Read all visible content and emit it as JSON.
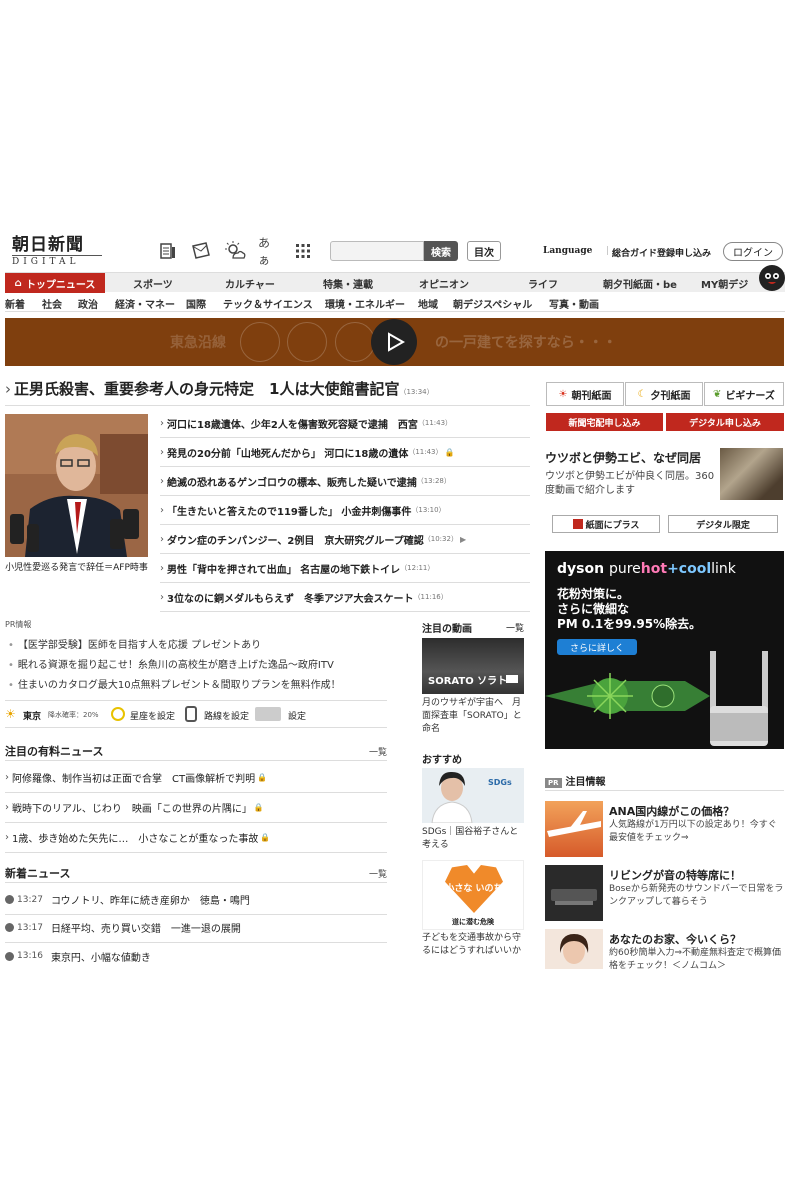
{
  "header": {
    "logo_main": "朝日新聞",
    "logo_sub": "DIGITAL",
    "search_placeholder": "",
    "search_button": "検索",
    "index_button": "目次",
    "language": "Language",
    "guide": "総合ガイド",
    "register": "登録申し込み",
    "login": "ログイン",
    "hiragana_icon_text": "あぁ"
  },
  "nav_primary": [
    {
      "label": "トップニュース",
      "active": true
    },
    {
      "label": "スポーツ"
    },
    {
      "label": "カルチャー"
    },
    {
      "label": "特集・連載"
    },
    {
      "label": "オピニオン"
    },
    {
      "label": "ライフ"
    },
    {
      "label": "朝夕刊紙面・be"
    },
    {
      "label": "MY朝デジ"
    }
  ],
  "nav_secondary": [
    "新着",
    "社会",
    "政治",
    "経済・マネー",
    "国際",
    "テック＆サイエンス",
    "環境・エネルギー",
    "地域",
    "朝デジスペシャル",
    "写真・動画"
  ],
  "banner": {
    "text_left": "東急沿線",
    "text_right": "の一戸建てを探すなら・・・"
  },
  "main_headline": {
    "title": "正男氏殺害、重要参考人の身元特定　1人は大使館書記官",
    "time": "（13:34）"
  },
  "photo_caption": "小児性愛巡る発言で辞任＝AFP時事",
  "headlines": [
    {
      "title": "河口に18歳遺体、少年2人を傷害致死容疑で逮捕　西宮",
      "time": "（11:43）",
      "lock": false
    },
    {
      "title": "発見の20分前「山地死んだから」 河口に18歳の遺体",
      "time": "（11:43）",
      "lock": true
    },
    {
      "title": "絶滅の恐れあるゲンゴロウの標本、販売した疑いで逮捕",
      "time": "（13:28）",
      "lock": false
    },
    {
      "title": "「生きたいと答えたので119番した」 小金井刺傷事件",
      "time": "（13:10）",
      "lock": false
    },
    {
      "title": "ダウン症のチンパンジー、2例目　京大研究グループ確認",
      "time": "（10:32）",
      "lock": false
    },
    {
      "title": "男性「背中を押されて出血」 名古屋の地下鉄トイレ",
      "time": "（12:11）",
      "lock": false
    },
    {
      "title": "3位なのに銅メダルもらえず　冬季アジア大会スケート",
      "time": "（11:16）",
      "lock": false
    }
  ],
  "pr": {
    "title": "PR情報",
    "items": [
      "【医学部受験】医師を目指す人を応援 プレゼントあり",
      "眠れる資源を掘り起こせ！糸魚川の高校生が磨き上げた逸品～政府ITV",
      "住まいのカタログ最大10点無料プレゼント＆間取りプランを無料作成！"
    ]
  },
  "utility": {
    "city": "東京",
    "rain": "降水確率：20%",
    "horoscope": "星座を設定",
    "route": "路線を設定",
    "settings": "設定"
  },
  "paid_news": {
    "title": "注目の有料ニュース",
    "more": "一覧",
    "items": [
      "阿修羅像、制作当初は正面で合掌　CT画像解析で判明",
      "戦時下のリアル、じわり　映画「この世界の片隅に」",
      "1歳、歩き始めた矢先に…　小さなことが重なった事故"
    ]
  },
  "new_news": {
    "title": "新着ニュース",
    "more": "一覧",
    "items": [
      {
        "time": "13:27",
        "title": "コウノトリ、昨年に続き産卵か　徳島・鳴門"
      },
      {
        "time": "13:17",
        "title": "日経平均、売り買い交錯　一進一退の展開"
      },
      {
        "time": "13:16",
        "title": "東京円、小幅な値動き"
      }
    ]
  },
  "middle": {
    "video_title": "注目の動画",
    "video_more": "一覧",
    "video_overlay": "SORATO ソラト",
    "video_caption": "月のウサギが宇宙へ　月面探査車「SORATO」と命名",
    "recommend_title": "おすすめ",
    "sdgs_badge": "SDGs",
    "recommend1_caption": "SDGs｜国谷裕子さんと考える",
    "recommend2_overlay": "小さな いのち",
    "recommend2_sub": "道に潜む危険",
    "recommend2_caption": "子どもを交通事故から守るにはどうすればいいか"
  },
  "right": {
    "paper_morning": "朝刊紙面",
    "paper_evening": "夕刊紙面",
    "paper_beginner": "ビギナーズ",
    "red_delivery": "新聞宅配申し込み",
    "red_digital": "デジタル申し込み",
    "feature_title": "ウツボと伊勢エビ、なぜ同居",
    "feature_desc": "ウツボと伊勢エビが仲良く同居。360度動画で紹介します",
    "btn_plus": "紙面にプラス",
    "btn_digital_only": "デジタル限定",
    "ad_brand": "dyson",
    "ad_pure": "pure",
    "ad_hot": "hot",
    "ad_cool": "+cool",
    "ad_link": "link",
    "ad_copy1": "花粉対策に。",
    "ad_copy2": "さらに微細な",
    "ad_copy3": "PM 0.1を99.95%除去。",
    "ad_cta": "さらに詳しく",
    "notice_badge": "PR",
    "notice_title": "注目情報",
    "notices": [
      {
        "title": "ANA国内線がこの価格？",
        "desc": "人気路線が1万円以下の設定あり！今すぐ最安値をチェック⇒"
      },
      {
        "title": "リビングが音の特等席に！",
        "desc": "Boseから新発売のサウンドバーで日常をランクアップして暮らそう"
      },
      {
        "title": "あなたのお家、今いくら？",
        "desc": "約60秒簡単入力⇒不動産無料査定で概算価格をチェック！＜ノムコム＞"
      }
    ]
  }
}
